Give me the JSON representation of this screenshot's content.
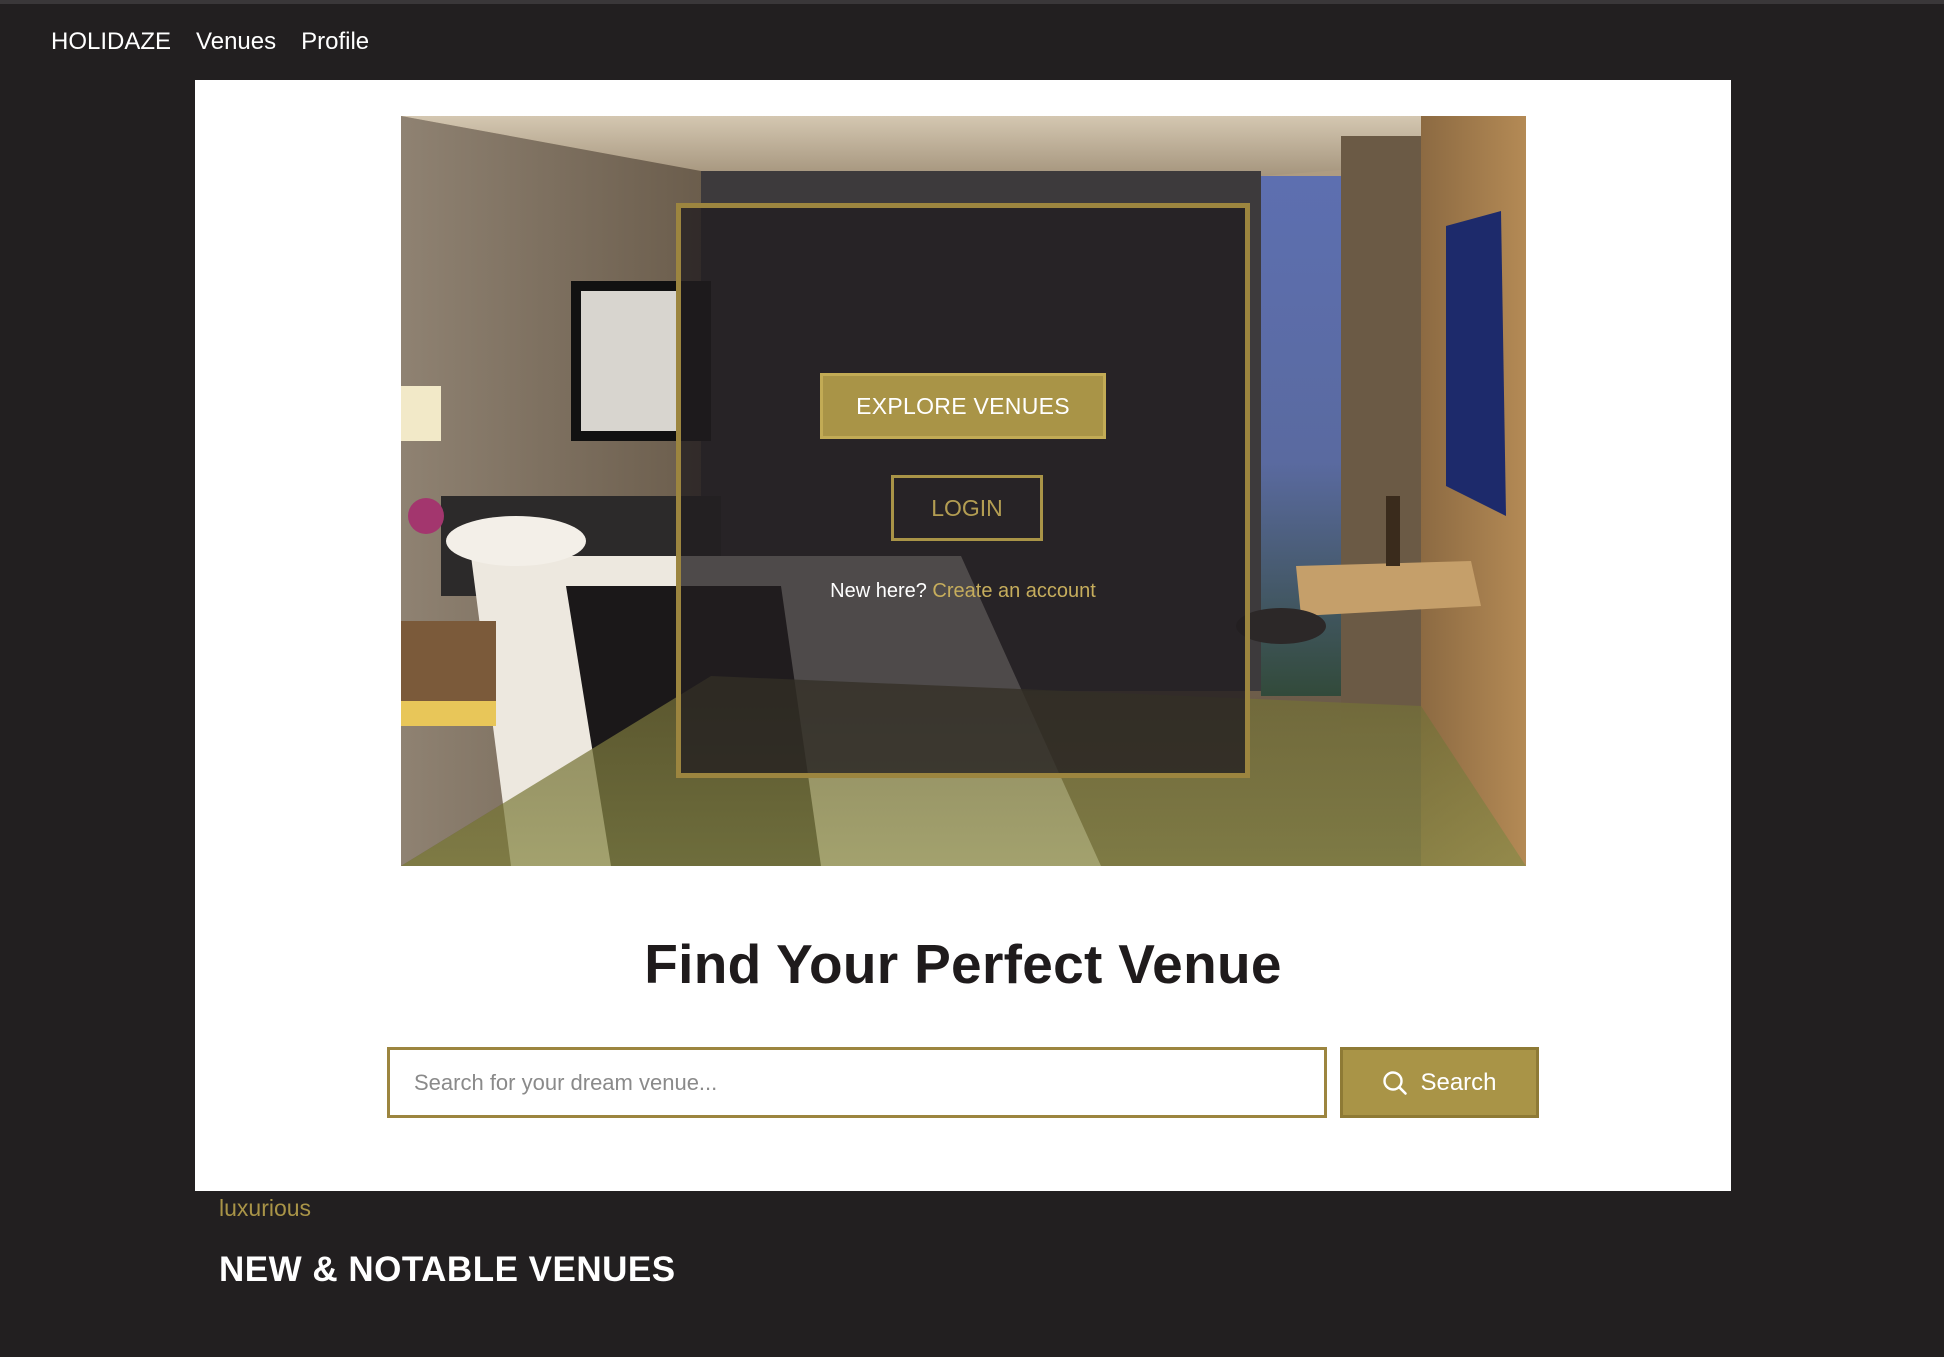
{
  "nav": {
    "brand": "HOLIDAZE",
    "items": [
      {
        "label": "Venues"
      },
      {
        "label": "Profile"
      }
    ]
  },
  "hero": {
    "explore_label": "EXPLORE VENUES",
    "login_label": "LOGIN",
    "new_here_text": "New here?",
    "create_account_label": "Create an account"
  },
  "main": {
    "title": "Find Your Perfect Venue",
    "search": {
      "placeholder": "Search for your dream venue...",
      "value": "",
      "button_label": "Search",
      "button_icon": "search-icon"
    }
  },
  "section": {
    "tag": "luxurious",
    "heading": "NEW & NOTABLE VENUES"
  },
  "colors": {
    "page_background": "#221f20",
    "accent_gold": "#a99447",
    "card_background": "#ffffff",
    "title_text": "#1f1b1c"
  }
}
